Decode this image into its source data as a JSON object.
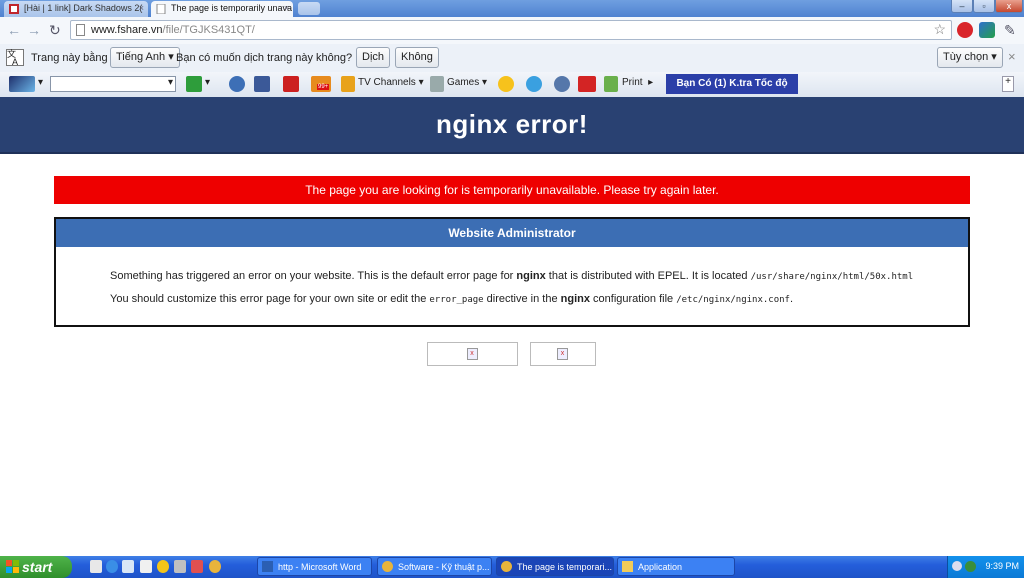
{
  "browser": {
    "tabs": [
      {
        "title": "[Hài | 1 link] Dark Shadows 2(",
        "active": false
      },
      {
        "title": "The page is temporarily unava",
        "active": true
      }
    ],
    "address": {
      "domain": "www.fshare.vn",
      "path": "/file/TGJKS431QT/"
    }
  },
  "translate_bar": {
    "prefix": "Trang này bằng",
    "language": "Tiếng Anh",
    "question": "Bạn có muốn dịch trang này không?",
    "translate_button": "Dịch",
    "no_button": "Không",
    "options_button": "Tùy chọn"
  },
  "toolbar": {
    "tv_channels": "TV Channels",
    "games": "Games",
    "print": "Print",
    "promo": "Bạn Có (1) K.tra Tốc độ",
    "badge": "99+"
  },
  "page": {
    "title": "nginx error!",
    "alert": "The page you are looking for is temporarily unavailable. Please try again later.",
    "admin": {
      "heading": "Website Administrator",
      "line1_a": "Something has triggered an error on your website. This is the default error page for ",
      "line1_b": "nginx",
      "line1_c": " that is distributed with EPEL. It is located ",
      "line1_d": "/usr/share/nginx/html/50x.html",
      "line2_a": "You should customize this error page for your own site or edit the ",
      "line2_b": "error_page",
      "line2_c": " directive in the ",
      "line2_d": "nginx",
      "line2_e": " configuration file ",
      "line2_f": "/etc/nginx/nginx.conf",
      "line2_g": "."
    }
  },
  "taskbar": {
    "start": "start",
    "tasks": [
      {
        "label": "http - Microsoft Word"
      },
      {
        "label": "Software - Kỹ thuật p..."
      },
      {
        "label": "The page is temporari..."
      },
      {
        "label": "Application"
      }
    ],
    "clock": "9:39 PM"
  },
  "colors": {
    "header_bg": "#294172",
    "alert_bg": "#ee0000",
    "admin_head_bg": "#3c6eb4"
  }
}
